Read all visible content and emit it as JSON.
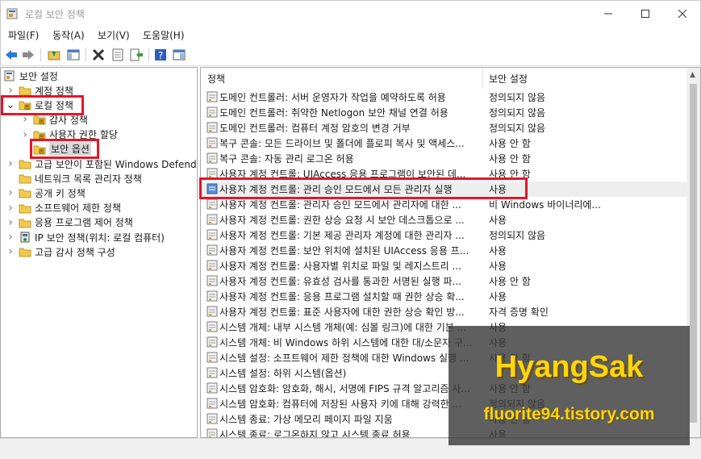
{
  "window": {
    "title": "로컬 보안 정책"
  },
  "menu": [
    "파일(F)",
    "동작(A)",
    "보기(V)",
    "도움말(H)"
  ],
  "tree": {
    "root": "보안 설정",
    "items": [
      {
        "label": "계정 정책",
        "level": 1,
        "expand": "collapsed",
        "icon": "folder-icon"
      },
      {
        "label": "로컬 정책",
        "level": 1,
        "expand": "expanded",
        "icon": "folder-open-icon"
      },
      {
        "label": "감사 정책",
        "level": 2,
        "expand": "collapsed",
        "icon": "folder-icon"
      },
      {
        "label": "사용자 권한 할당",
        "level": 2,
        "expand": "collapsed",
        "icon": "folder-icon"
      },
      {
        "label": "보안 옵션",
        "level": 2,
        "expand": "none",
        "icon": "folder-icon",
        "selected": true
      },
      {
        "label": "고급 보안이 포함된 Windows Defend",
        "level": 1,
        "expand": "collapsed",
        "icon": "folder-icon"
      },
      {
        "label": "네트워크 목록 관리자 정책",
        "level": 1,
        "expand": "none",
        "icon": "folder-icon"
      },
      {
        "label": "공개 키 정책",
        "level": 1,
        "expand": "collapsed",
        "icon": "folder-icon"
      },
      {
        "label": "소프트웨어 제한 정책",
        "level": 1,
        "expand": "collapsed",
        "icon": "folder-icon"
      },
      {
        "label": "응용 프로그램 제어 정책",
        "level": 1,
        "expand": "collapsed",
        "icon": "folder-icon"
      },
      {
        "label": "IP 보안 정책(위치: 로컬 컴퓨터)",
        "level": 1,
        "expand": "collapsed",
        "icon": "ip-security-icon"
      },
      {
        "label": "고급 감사 정책 구성",
        "level": 1,
        "expand": "collapsed",
        "icon": "folder-icon"
      }
    ]
  },
  "list": {
    "columns": {
      "policy": "정책",
      "setting": "보안 설정"
    },
    "rows": [
      {
        "policy": "도메인 컨트롤러: 서버 운영자가 작업을 예약하도록 허용",
        "setting": "정의되지 않음"
      },
      {
        "policy": "도메인 컨트롤러: 취약한 Netlogon 보안 채널 연결 허용",
        "setting": "정의되지 않음"
      },
      {
        "policy": "도메인 컨트롤러: 컴퓨터 계정 암호의 변경 거부",
        "setting": "정의되지 않음"
      },
      {
        "policy": "복구 콘솔: 모든 드라이브 및 폴더에 플로피 복사 및 액세스...",
        "setting": "사용 안 함"
      },
      {
        "policy": "복구 콘솔: 자동 관리 로그온 허용",
        "setting": "사용 안 함"
      },
      {
        "policy": "사용자 계정 컨트롤: UIAccess 응용 프로그램이 보안된 데...",
        "setting": "사용 안 함"
      },
      {
        "policy": "사용자 계정 컨트롤: 관리 승인 모드에서 모든 관리자 실행",
        "setting": "사용",
        "highlight": true
      },
      {
        "policy": "사용자 계정 컨트롤: 관리자 승인 모드에서 관리자에 대한 ...",
        "setting": "비 Windows 바이너리에..."
      },
      {
        "policy": "사용자 계정 컨트롤: 권한 상승 요청 시 보안 데스크톱으로 ...",
        "setting": "사용"
      },
      {
        "policy": "사용자 계정 컨트롤: 기본 제공 관리자 계정에 대한 관리자 ...",
        "setting": "정의되지 않음"
      },
      {
        "policy": "사용자 계정 컨트롤: 보안 위치에 설치된 UIAccess 응용 프...",
        "setting": "사용"
      },
      {
        "policy": "사용자 계정 컨트롤: 사용자별 위치로 파일 및 레지스트리 ...",
        "setting": "사용"
      },
      {
        "policy": "사용자 계정 컨트롤: 유효성 검사를 통과한 서명된 실행 파...",
        "setting": "사용 안 함"
      },
      {
        "policy": "사용자 계정 컨트롤: 응용 프로그램 설치할 때 권한 상승 확...",
        "setting": "사용"
      },
      {
        "policy": "사용자 계정 컨트롤: 표준 사용자에 대한 권한 상승 확인 방...",
        "setting": "자격 증명 확인"
      },
      {
        "policy": "시스템 개체: 내부 시스템 개체(예: 심볼 링크)에 대한 기본 ...",
        "setting": "사용"
      },
      {
        "policy": "시스템 개체: 비 Windows 하위 시스템에 대한 대/소문자 구...",
        "setting": "사용"
      },
      {
        "policy": "시스템 설정: 소프트웨어 제한 정책에 대한 Windows 실행 ...",
        "setting": "사용 안 함"
      },
      {
        "policy": "시스템 설정: 하위 시스템(옵션)",
        "setting": ""
      },
      {
        "policy": "시스템 암호화: 암호화, 해시, 서명에 FIPS 규격 알고리즘 사...",
        "setting": "사용 안 함"
      },
      {
        "policy": "시스템 암호화: 컴퓨터에 저장된 사용자 키에 대해 강력한 ...",
        "setting": "정의되지 않음"
      },
      {
        "policy": "시스템 종료: 가상 메모리 페이지 파일 지움",
        "setting": "사용 안 함"
      },
      {
        "policy": "시스템 종료: 로그온하지 않고 시스템 종료 허용",
        "setting": "사용"
      }
    ]
  },
  "watermark": {
    "title": "HyangSak",
    "subtitle": "fluorite94.tistory.com"
  },
  "colors": {
    "highlight_box": "#e8142a",
    "watermark_text": "#ffd60a",
    "selection": "#d9d9d9"
  }
}
